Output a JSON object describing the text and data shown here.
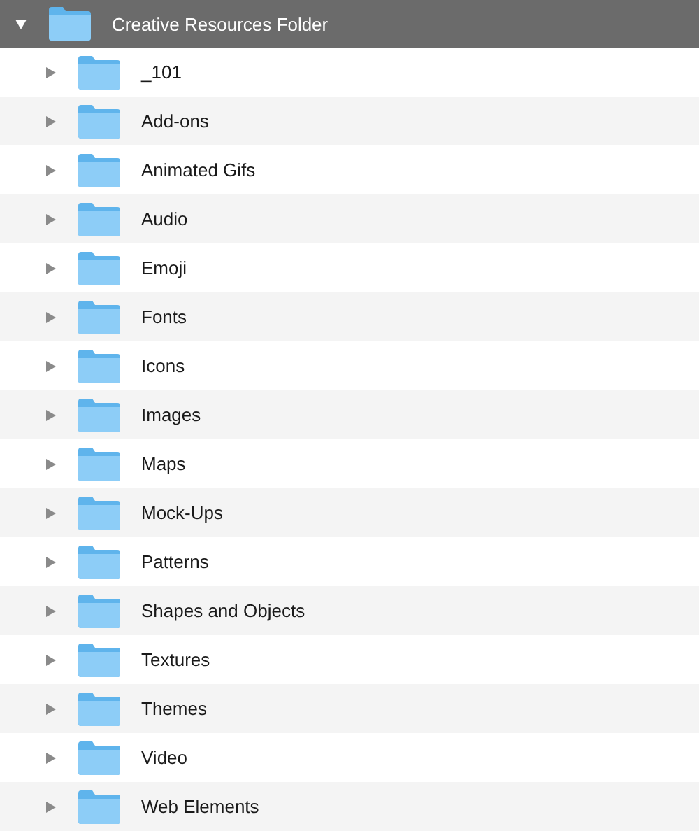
{
  "tree": [
    {
      "name": "Creative Resources Folder",
      "expanded": true,
      "selected": true,
      "children": [
        {
          "name": "_101",
          "expanded": false,
          "selected": false
        },
        {
          "name": "Add-ons",
          "expanded": false,
          "selected": false
        },
        {
          "name": "Animated Gifs",
          "expanded": false,
          "selected": false
        },
        {
          "name": "Audio",
          "expanded": false,
          "selected": false
        },
        {
          "name": "Emoji",
          "expanded": false,
          "selected": false
        },
        {
          "name": "Fonts",
          "expanded": false,
          "selected": false
        },
        {
          "name": "Icons",
          "expanded": false,
          "selected": false
        },
        {
          "name": "Images",
          "expanded": false,
          "selected": false
        },
        {
          "name": "Maps",
          "expanded": false,
          "selected": false
        },
        {
          "name": "Mock-Ups",
          "expanded": false,
          "selected": false
        },
        {
          "name": "Patterns",
          "expanded": false,
          "selected": false
        },
        {
          "name": "Shapes and Objects",
          "expanded": false,
          "selected": false
        },
        {
          "name": "Textures",
          "expanded": false,
          "selected": false
        },
        {
          "name": "Themes",
          "expanded": false,
          "selected": false
        },
        {
          "name": "Video",
          "expanded": false,
          "selected": false
        },
        {
          "name": "Web Elements",
          "expanded": false,
          "selected": false
        }
      ]
    }
  ]
}
